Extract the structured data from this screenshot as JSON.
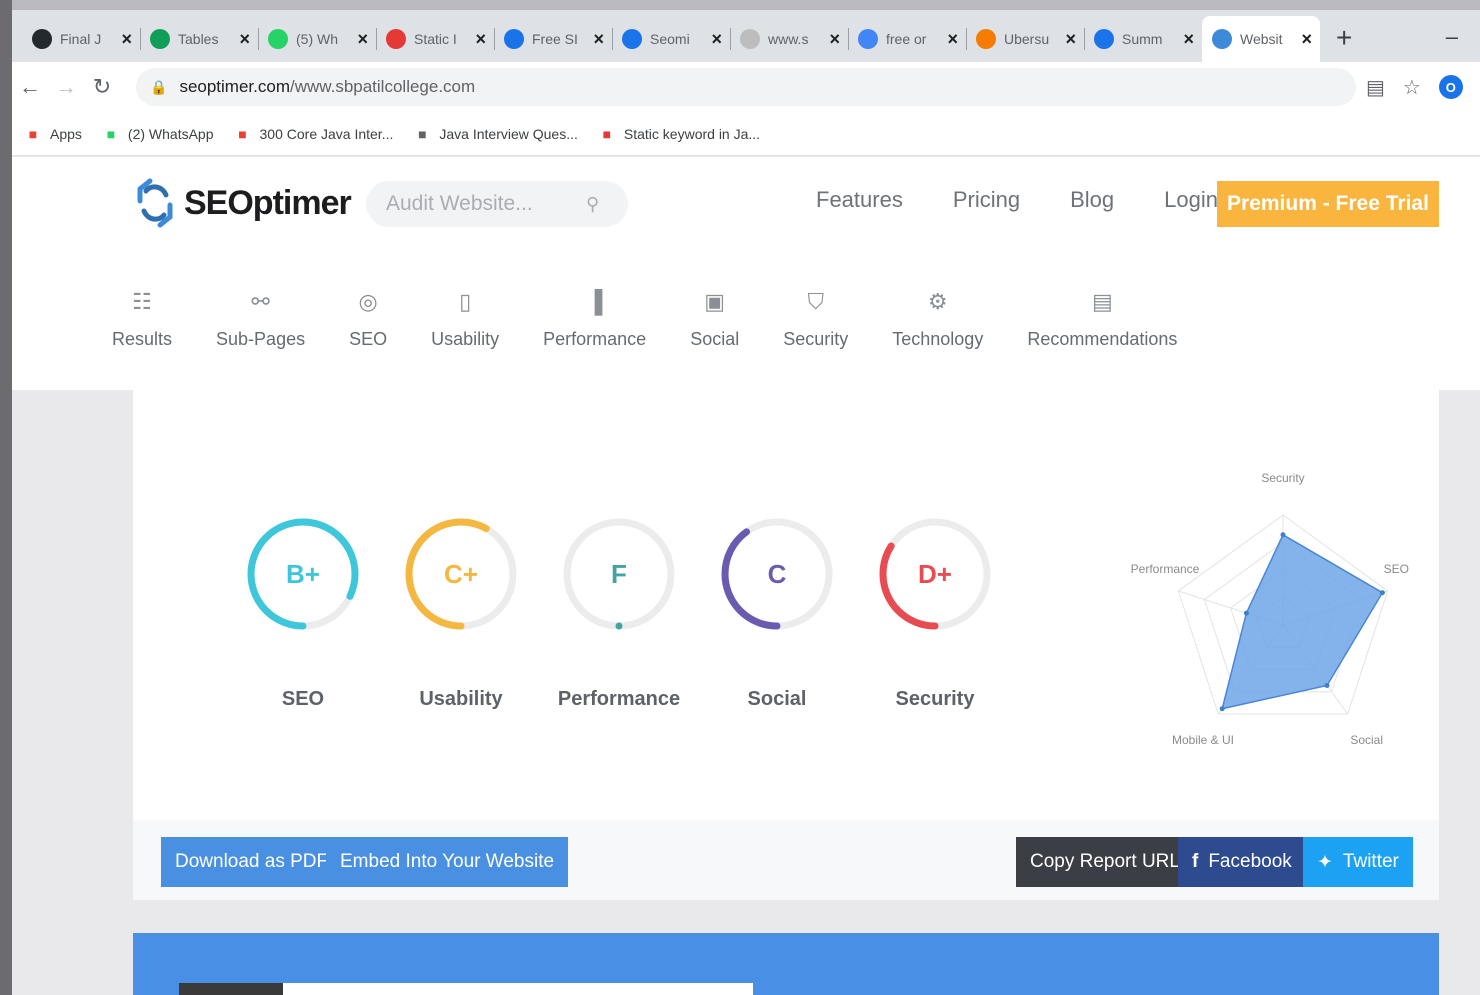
{
  "browser": {
    "tabs": [
      {
        "title": "Final J",
        "icon": "github-icon",
        "color": "#24292e"
      },
      {
        "title": "Tables",
        "icon": "sheets-icon",
        "color": "#0f9d58"
      },
      {
        "title": "(5) Wh",
        "icon": "whatsapp-icon",
        "color": "#25d366"
      },
      {
        "title": "Static I",
        "icon": "v-logo-icon",
        "color": "#e53935"
      },
      {
        "title": "Free SI",
        "icon": "page-icon",
        "color": "#1a73e8"
      },
      {
        "title": "Seomi",
        "icon": "page-icon",
        "color": "#1a73e8"
      },
      {
        "title": "www.s",
        "icon": "blank-page-icon",
        "color": "#bdbdbd"
      },
      {
        "title": "free or",
        "icon": "google-icon",
        "color": "#4285f4"
      },
      {
        "title": "Ubersu",
        "icon": "ubersuggest-icon",
        "color": "#f57c00"
      },
      {
        "title": "Summ",
        "icon": "pen-icon",
        "color": "#1a73e8"
      },
      {
        "title": "Websit",
        "icon": "seoptimer-icon",
        "color": "#3d8bd8",
        "active": true
      }
    ],
    "new_tab": "+",
    "minimize": "–",
    "url_host": "seoptimer.com",
    "url_path": "/www.sbpatilcollege.com",
    "bookmarks": [
      {
        "label": "Apps",
        "icon": "apps-grid-icon",
        "color": "#ea4335"
      },
      {
        "label": "(2) WhatsApp",
        "icon": "whatsapp-icon",
        "color": "#25d366"
      },
      {
        "label": "300 Core Java Inter...",
        "icon": "gmail-icon",
        "color": "#ea4335"
      },
      {
        "label": "Java Interview Ques...",
        "icon": "diamond-icon",
        "color": "#5f6368"
      },
      {
        "label": "Static keyword in Ja...",
        "icon": "v-logo-icon",
        "color": "#e53935"
      }
    ]
  },
  "site": {
    "logo_text": "SEOptimer",
    "audit_placeholder": "Audit Website...",
    "nav": [
      "Features",
      "Pricing",
      "Blog",
      "Login"
    ],
    "cta": "Premium - Free Trial",
    "subnav": [
      {
        "label": "Results",
        "icon": "grid-icon"
      },
      {
        "label": "Sub-Pages",
        "icon": "link-icon"
      },
      {
        "label": "SEO",
        "icon": "target-icon"
      },
      {
        "label": "Usability",
        "icon": "mobile-icon"
      },
      {
        "label": "Performance",
        "icon": "bar-chart-icon"
      },
      {
        "label": "Social",
        "icon": "folder-icon"
      },
      {
        "label": "Security",
        "icon": "shield-icon"
      },
      {
        "label": "Technology",
        "icon": "gears-icon"
      },
      {
        "label": "Recommendations",
        "icon": "clipboard-icon"
      }
    ]
  },
  "report": {
    "grades": [
      {
        "grade": "B+",
        "label": "SEO",
        "color": "#3ec6db",
        "fill": 0.82
      },
      {
        "grade": "C+",
        "label": "Usability",
        "color": "#f4b740",
        "fill": 0.58
      },
      {
        "grade": "F",
        "label": "Performance",
        "color": "#43a3a0",
        "fill": 0.0
      },
      {
        "grade": "C",
        "label": "Social",
        "color": "#6a5bb1",
        "fill": 0.4
      },
      {
        "grade": "D+",
        "label": "Security",
        "color": "#e84c53",
        "fill": 0.34
      }
    ],
    "radar": {
      "axes": [
        "Security",
        "SEO",
        "Social",
        "Mobile & UI",
        "Performance"
      ],
      "values": [
        0.82,
        0.95,
        0.68,
        0.94,
        0.35
      ],
      "fill_color": "#6ea6e8"
    }
  },
  "actions": {
    "download_pdf": "Download as PDF",
    "embed": "Embed Into Your Website",
    "copy_url": "Copy Report URL",
    "facebook": "Facebook",
    "twitter": "Twitter"
  }
}
